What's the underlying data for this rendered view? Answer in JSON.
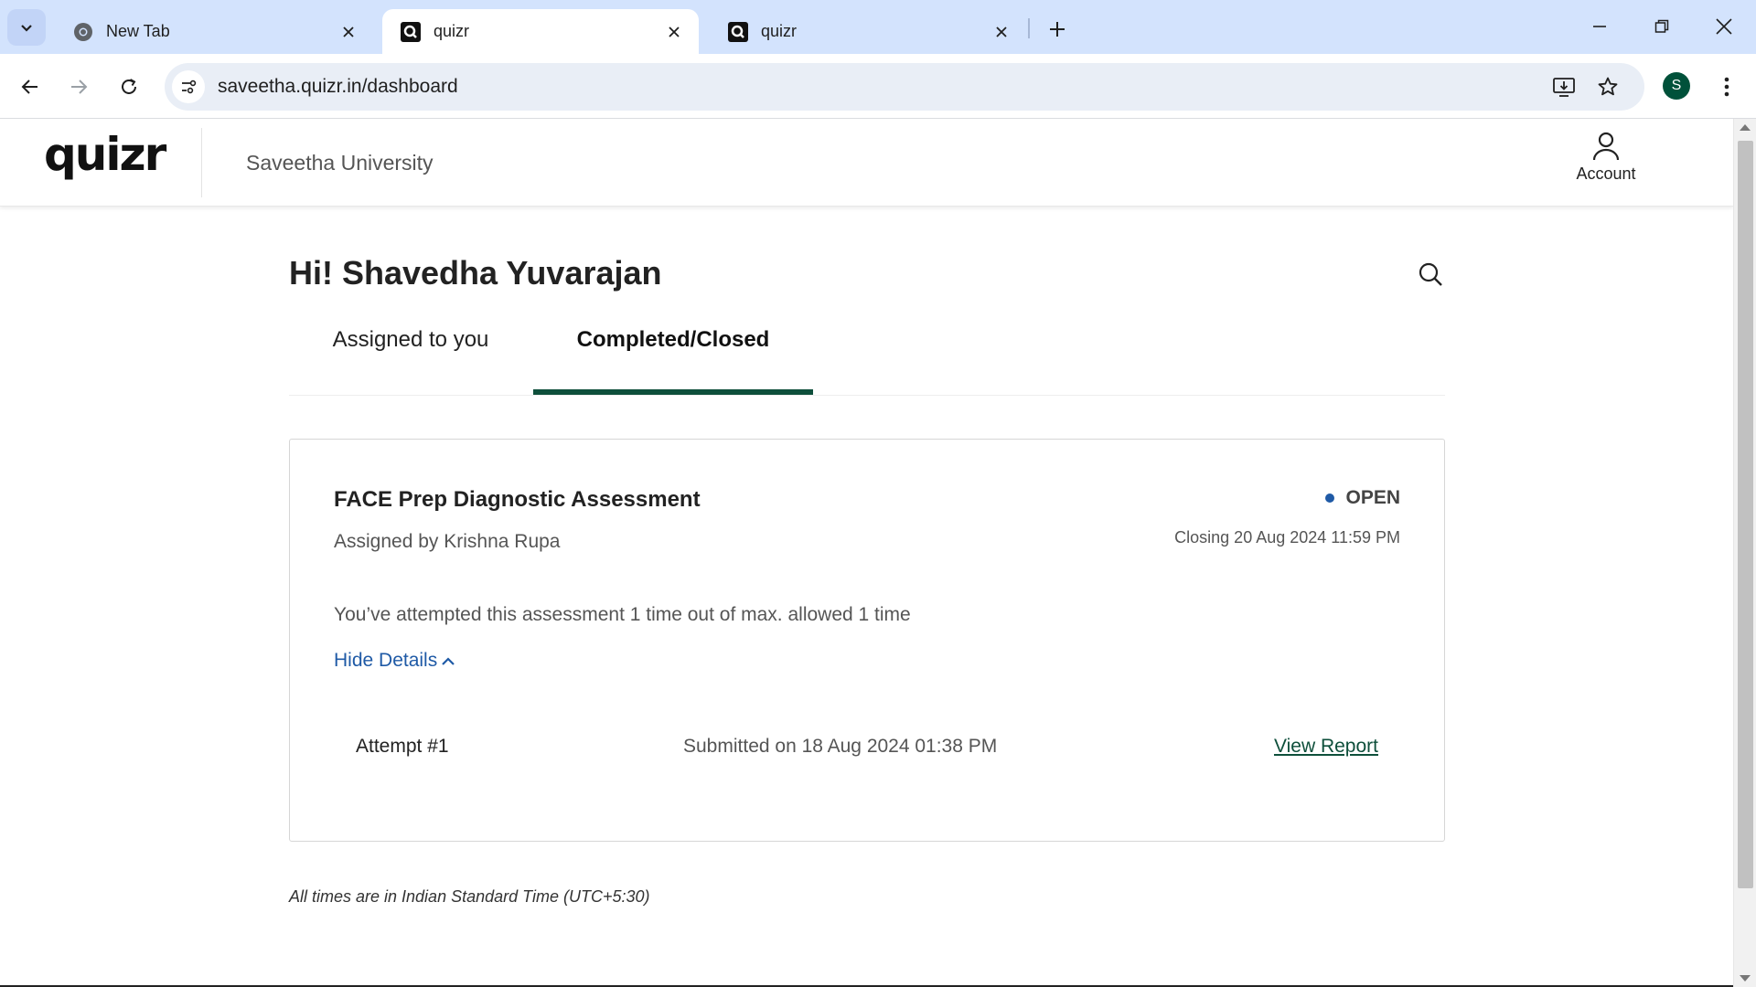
{
  "browser": {
    "tabs": [
      {
        "title": "New Tab",
        "icon": "chrome-icon",
        "active": false
      },
      {
        "title": "quizr",
        "icon": "quizr-favicon",
        "active": true
      },
      {
        "title": "quizr",
        "icon": "quizr-favicon",
        "active": false
      }
    ],
    "url": "saveetha.quizr.in/dashboard",
    "profile_initial": "S",
    "profile_color": "#00513a"
  },
  "header": {
    "logo": "quizr",
    "university": "Saveetha University",
    "account_label": "Account"
  },
  "main": {
    "greeting": "Hi! Shavedha Yuvarajan",
    "tabs": [
      {
        "label": "Assigned to you",
        "selected": false
      },
      {
        "label": "Completed/Closed",
        "selected": true
      }
    ]
  },
  "assessment": {
    "title": "FACE Prep Diagnostic Assessment",
    "assigned_by": "Assigned by Krishna Rupa",
    "status": "OPEN",
    "status_color": "#1f5aa6",
    "closing": "Closing 20 Aug 2024 11:59 PM",
    "attempt_info": "You’ve attempted this assessment 1 time out of max. allowed 1 time",
    "toggle_label": "Hide Details",
    "attempts": [
      {
        "label": "Attempt #1",
        "submitted": "Submitted on 18 Aug 2024 01:38 PM",
        "action": "View Report"
      }
    ]
  },
  "footer_note": "All times are in Indian Standard Time (UTC+5:30)",
  "colors": {
    "accent": "#0e4f3b",
    "link": "#1f5aa6",
    "tabstrip": "#d3e3fd"
  }
}
